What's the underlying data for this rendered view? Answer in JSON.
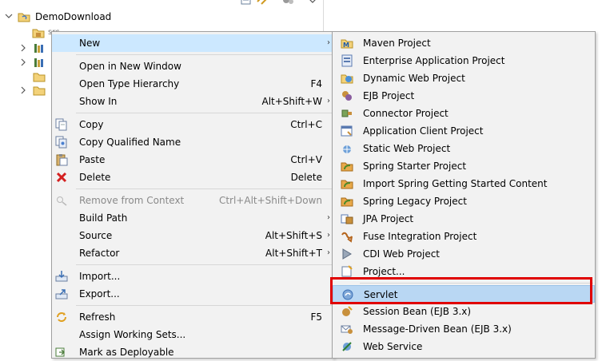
{
  "explorer": {
    "project_name": "DemoDownload",
    "src_label": "src"
  },
  "context_menu": {
    "items": [
      {
        "label": "New",
        "shortcut": "",
        "icon": "none",
        "submenu": true
      },
      {
        "label": "Open in New Window",
        "shortcut": "",
        "icon": "none"
      },
      {
        "label": "Open Type Hierarchy",
        "shortcut": "F4",
        "icon": "none"
      },
      {
        "label": "Show In",
        "shortcut": "Alt+Shift+W",
        "icon": "none",
        "submenu": true
      },
      {
        "label": "Copy",
        "shortcut": "Ctrl+C",
        "icon": "copy-icon"
      },
      {
        "label": "Copy Qualified Name",
        "shortcut": "",
        "icon": "copy-qualified-name-icon"
      },
      {
        "label": "Paste",
        "shortcut": "Ctrl+V",
        "icon": "paste-icon"
      },
      {
        "label": "Delete",
        "shortcut": "Delete",
        "icon": "delete-icon"
      },
      {
        "label": "Remove from Context",
        "shortcut": "Ctrl+Alt+Shift+Down",
        "icon": "remove-from-context-icon",
        "disabled": true
      },
      {
        "label": "Build Path",
        "shortcut": "",
        "icon": "none",
        "submenu": true
      },
      {
        "label": "Source",
        "shortcut": "Alt+Shift+S",
        "icon": "none",
        "submenu": true
      },
      {
        "label": "Refactor",
        "shortcut": "Alt+Shift+T",
        "icon": "none",
        "submenu": true
      },
      {
        "label": "Import...",
        "shortcut": "",
        "icon": "import-icon"
      },
      {
        "label": "Export...",
        "shortcut": "",
        "icon": "export-icon"
      },
      {
        "label": "Refresh",
        "shortcut": "F5",
        "icon": "refresh-icon"
      },
      {
        "label": "Assign Working Sets...",
        "shortcut": "",
        "icon": "none"
      },
      {
        "label": "Mark as Deployable",
        "shortcut": "",
        "icon": "mark-deployable-icon"
      }
    ],
    "submenu_arrow": "›"
  },
  "new_submenu": {
    "items": [
      {
        "label": "Maven Project",
        "icon": "maven-project-icon"
      },
      {
        "label": "Enterprise Application Project",
        "icon": "enterprise-app-project-icon"
      },
      {
        "label": "Dynamic Web Project",
        "icon": "dynamic-web-project-icon"
      },
      {
        "label": "EJB Project",
        "icon": "ejb-project-icon"
      },
      {
        "label": "Connector Project",
        "icon": "connector-project-icon"
      },
      {
        "label": "Application Client Project",
        "icon": "application-client-project-icon"
      },
      {
        "label": "Static Web Project",
        "icon": "static-web-project-icon"
      },
      {
        "label": "Spring Starter Project",
        "icon": "spring-starter-project-icon"
      },
      {
        "label": "Import Spring Getting Started Content",
        "icon": "spring-import-icon"
      },
      {
        "label": "Spring Legacy Project",
        "icon": "spring-legacy-project-icon"
      },
      {
        "label": "JPA Project",
        "icon": "jpa-project-icon"
      },
      {
        "label": "Fuse Integration Project",
        "icon": "fuse-integration-project-icon"
      },
      {
        "label": "CDI Web Project",
        "icon": "cdi-web-project-icon"
      },
      {
        "label": "Project...",
        "icon": "project-icon"
      },
      {
        "label": "Servlet",
        "icon": "servlet-icon",
        "selected": true
      },
      {
        "label": "Session Bean (EJB 3.x)",
        "icon": "session-bean-icon"
      },
      {
        "label": "Message-Driven Bean (EJB 3.x)",
        "icon": "message-driven-bean-icon"
      },
      {
        "label": "Web Service",
        "icon": "web-service-icon"
      }
    ]
  },
  "colors": {
    "menu_bg": "#f2f2f2",
    "hover_bg": "#cce8ff",
    "selected_bg": "#b9d7f3",
    "annotation_red": "#e00000"
  }
}
